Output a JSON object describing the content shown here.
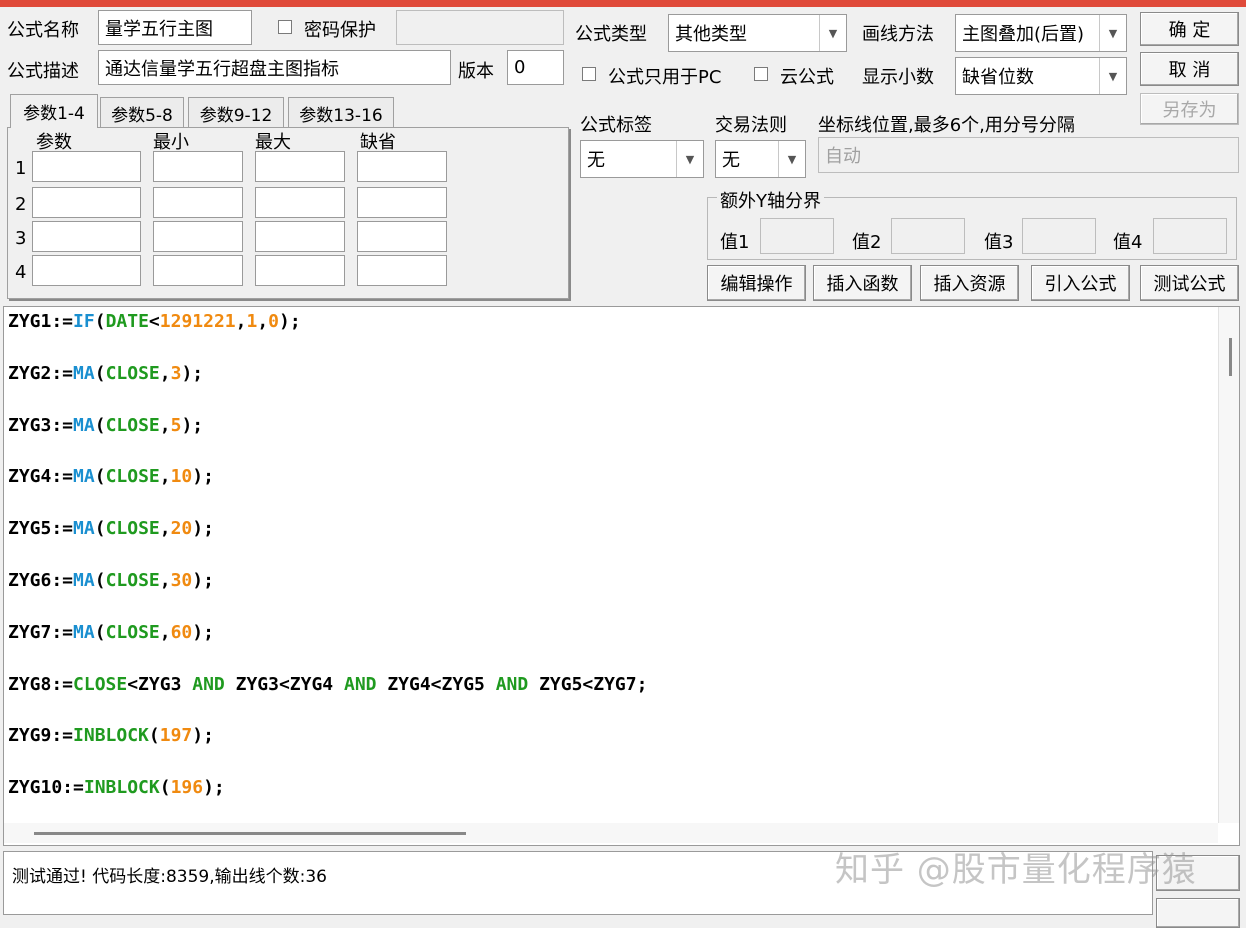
{
  "header": {
    "name_label": "公式名称",
    "name_value": "量学五行主图",
    "password_label": "密码保护",
    "desc_label": "公式描述",
    "desc_value": "通达信量学五行超盘主图指标",
    "version_label": "版本",
    "version_value": "0"
  },
  "options": {
    "type_label": "公式类型",
    "type_value": "其他类型",
    "draw_label": "画线方法",
    "draw_value": "主图叠加(后置)",
    "pc_only_label": "公式只用于PC",
    "cloud_label": "云公式",
    "decimals_label": "显示小数",
    "decimals_value": "缺省位数",
    "tag_label": "公式标签",
    "tag_value": "无",
    "rule_label": "交易法则",
    "rule_value": "无",
    "axis_label": "坐标线位置,最多6个,用分号分隔",
    "axis_value": "自动",
    "extra_y_label": "额外Y轴分界",
    "val1_label": "值1",
    "val2_label": "值2",
    "val3_label": "值3",
    "val4_label": "值4"
  },
  "buttons": {
    "ok": "确  定",
    "cancel": "取  消",
    "save_as": "另存为",
    "edit_ops": "编辑操作",
    "insert_func": "插入函数",
    "insert_res": "插入资源",
    "import_formula": "引入公式",
    "test_formula": "测试公式"
  },
  "tabs": [
    "参数1-4",
    "参数5-8",
    "参数9-12",
    "参数13-16"
  ],
  "params": {
    "headers": [
      "参数",
      "最小",
      "最大",
      "缺省"
    ],
    "rows": [
      "1",
      "2",
      "3",
      "4"
    ]
  },
  "code": {
    "lines": [
      [
        [
          "ZYG1:=",
          ""
        ],
        [
          "IF",
          "f"
        ],
        [
          "(",
          ""
        ],
        [
          "DATE",
          "v"
        ],
        [
          "<",
          ""
        ],
        [
          "1291221",
          "n"
        ],
        [
          ",",
          ""
        ],
        [
          "1",
          "n"
        ],
        [
          ",",
          ""
        ],
        [
          "0",
          "n"
        ],
        [
          ");",
          ""
        ]
      ],
      [
        [
          "ZYG2:=",
          ""
        ],
        [
          "MA",
          "f"
        ],
        [
          "(",
          ""
        ],
        [
          "CLOSE",
          "v"
        ],
        [
          ",",
          ""
        ],
        [
          "3",
          "n"
        ],
        [
          ");",
          ""
        ]
      ],
      [
        [
          "ZYG3:=",
          ""
        ],
        [
          "MA",
          "f"
        ],
        [
          "(",
          ""
        ],
        [
          "CLOSE",
          "v"
        ],
        [
          ",",
          ""
        ],
        [
          "5",
          "n"
        ],
        [
          ");",
          ""
        ]
      ],
      [
        [
          "ZYG4:=",
          ""
        ],
        [
          "MA",
          "f"
        ],
        [
          "(",
          ""
        ],
        [
          "CLOSE",
          "v"
        ],
        [
          ",",
          ""
        ],
        [
          "10",
          "n"
        ],
        [
          ");",
          ""
        ]
      ],
      [
        [
          "ZYG5:=",
          ""
        ],
        [
          "MA",
          "f"
        ],
        [
          "(",
          ""
        ],
        [
          "CLOSE",
          "v"
        ],
        [
          ",",
          ""
        ],
        [
          "20",
          "n"
        ],
        [
          ");",
          ""
        ]
      ],
      [
        [
          "ZYG6:=",
          ""
        ],
        [
          "MA",
          "f"
        ],
        [
          "(",
          ""
        ],
        [
          "CLOSE",
          "v"
        ],
        [
          ",",
          ""
        ],
        [
          "30",
          "n"
        ],
        [
          ");",
          ""
        ]
      ],
      [
        [
          "ZYG7:=",
          ""
        ],
        [
          "MA",
          "f"
        ],
        [
          "(",
          ""
        ],
        [
          "CLOSE",
          "v"
        ],
        [
          ",",
          ""
        ],
        [
          "60",
          "n"
        ],
        [
          ");",
          ""
        ]
      ],
      [
        [
          "ZYG8:=",
          ""
        ],
        [
          "CLOSE",
          "v"
        ],
        [
          "<ZYG3 ",
          ""
        ],
        [
          "AND",
          "v"
        ],
        [
          " ZYG3<ZYG4 ",
          ""
        ],
        [
          "AND",
          "v"
        ],
        [
          " ZYG4<ZYG5 ",
          ""
        ],
        [
          "AND",
          "v"
        ],
        [
          " ZYG5<ZYG7;",
          ""
        ]
      ],
      [
        [
          "ZYG9:=",
          ""
        ],
        [
          "INBLOCK",
          "v"
        ],
        [
          "(",
          ""
        ],
        [
          "197",
          "n"
        ],
        [
          ");",
          ""
        ]
      ],
      [
        [
          "ZYG10:=",
          ""
        ],
        [
          "INBLOCK",
          "v"
        ],
        [
          "(",
          ""
        ],
        [
          "196",
          "n"
        ],
        [
          ");",
          ""
        ]
      ]
    ]
  },
  "status": {
    "message": "测试通过! 代码长度:8359,输出线个数:36",
    "watermark": "知乎 @股市量化程序猿"
  },
  "colors": {
    "function": "#1a8fd0",
    "variable": "#1f9a1f",
    "number": "#f08a10"
  }
}
